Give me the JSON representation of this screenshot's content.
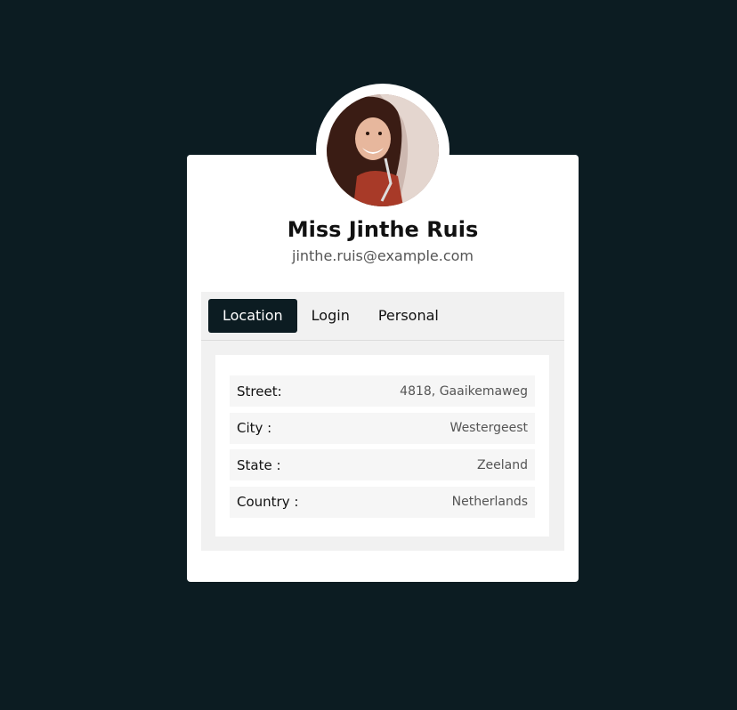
{
  "profile": {
    "name": "Miss Jinthe Ruis",
    "email": "jinthe.ruis@example.com"
  },
  "tabs": [
    {
      "label": "Location",
      "active": true
    },
    {
      "label": "Login",
      "active": false
    },
    {
      "label": "Personal",
      "active": false
    }
  ],
  "location": {
    "rows": [
      {
        "label": "Street:",
        "value": "4818, Gaaikemaweg"
      },
      {
        "label": "City :",
        "value": "Westergeest"
      },
      {
        "label": "State :",
        "value": "Zeeland"
      },
      {
        "label": "Country :",
        "value": "Netherlands"
      }
    ]
  },
  "colors": {
    "background": "#0c1c22",
    "card": "#ffffff",
    "active_tab": "#0c1c22"
  }
}
